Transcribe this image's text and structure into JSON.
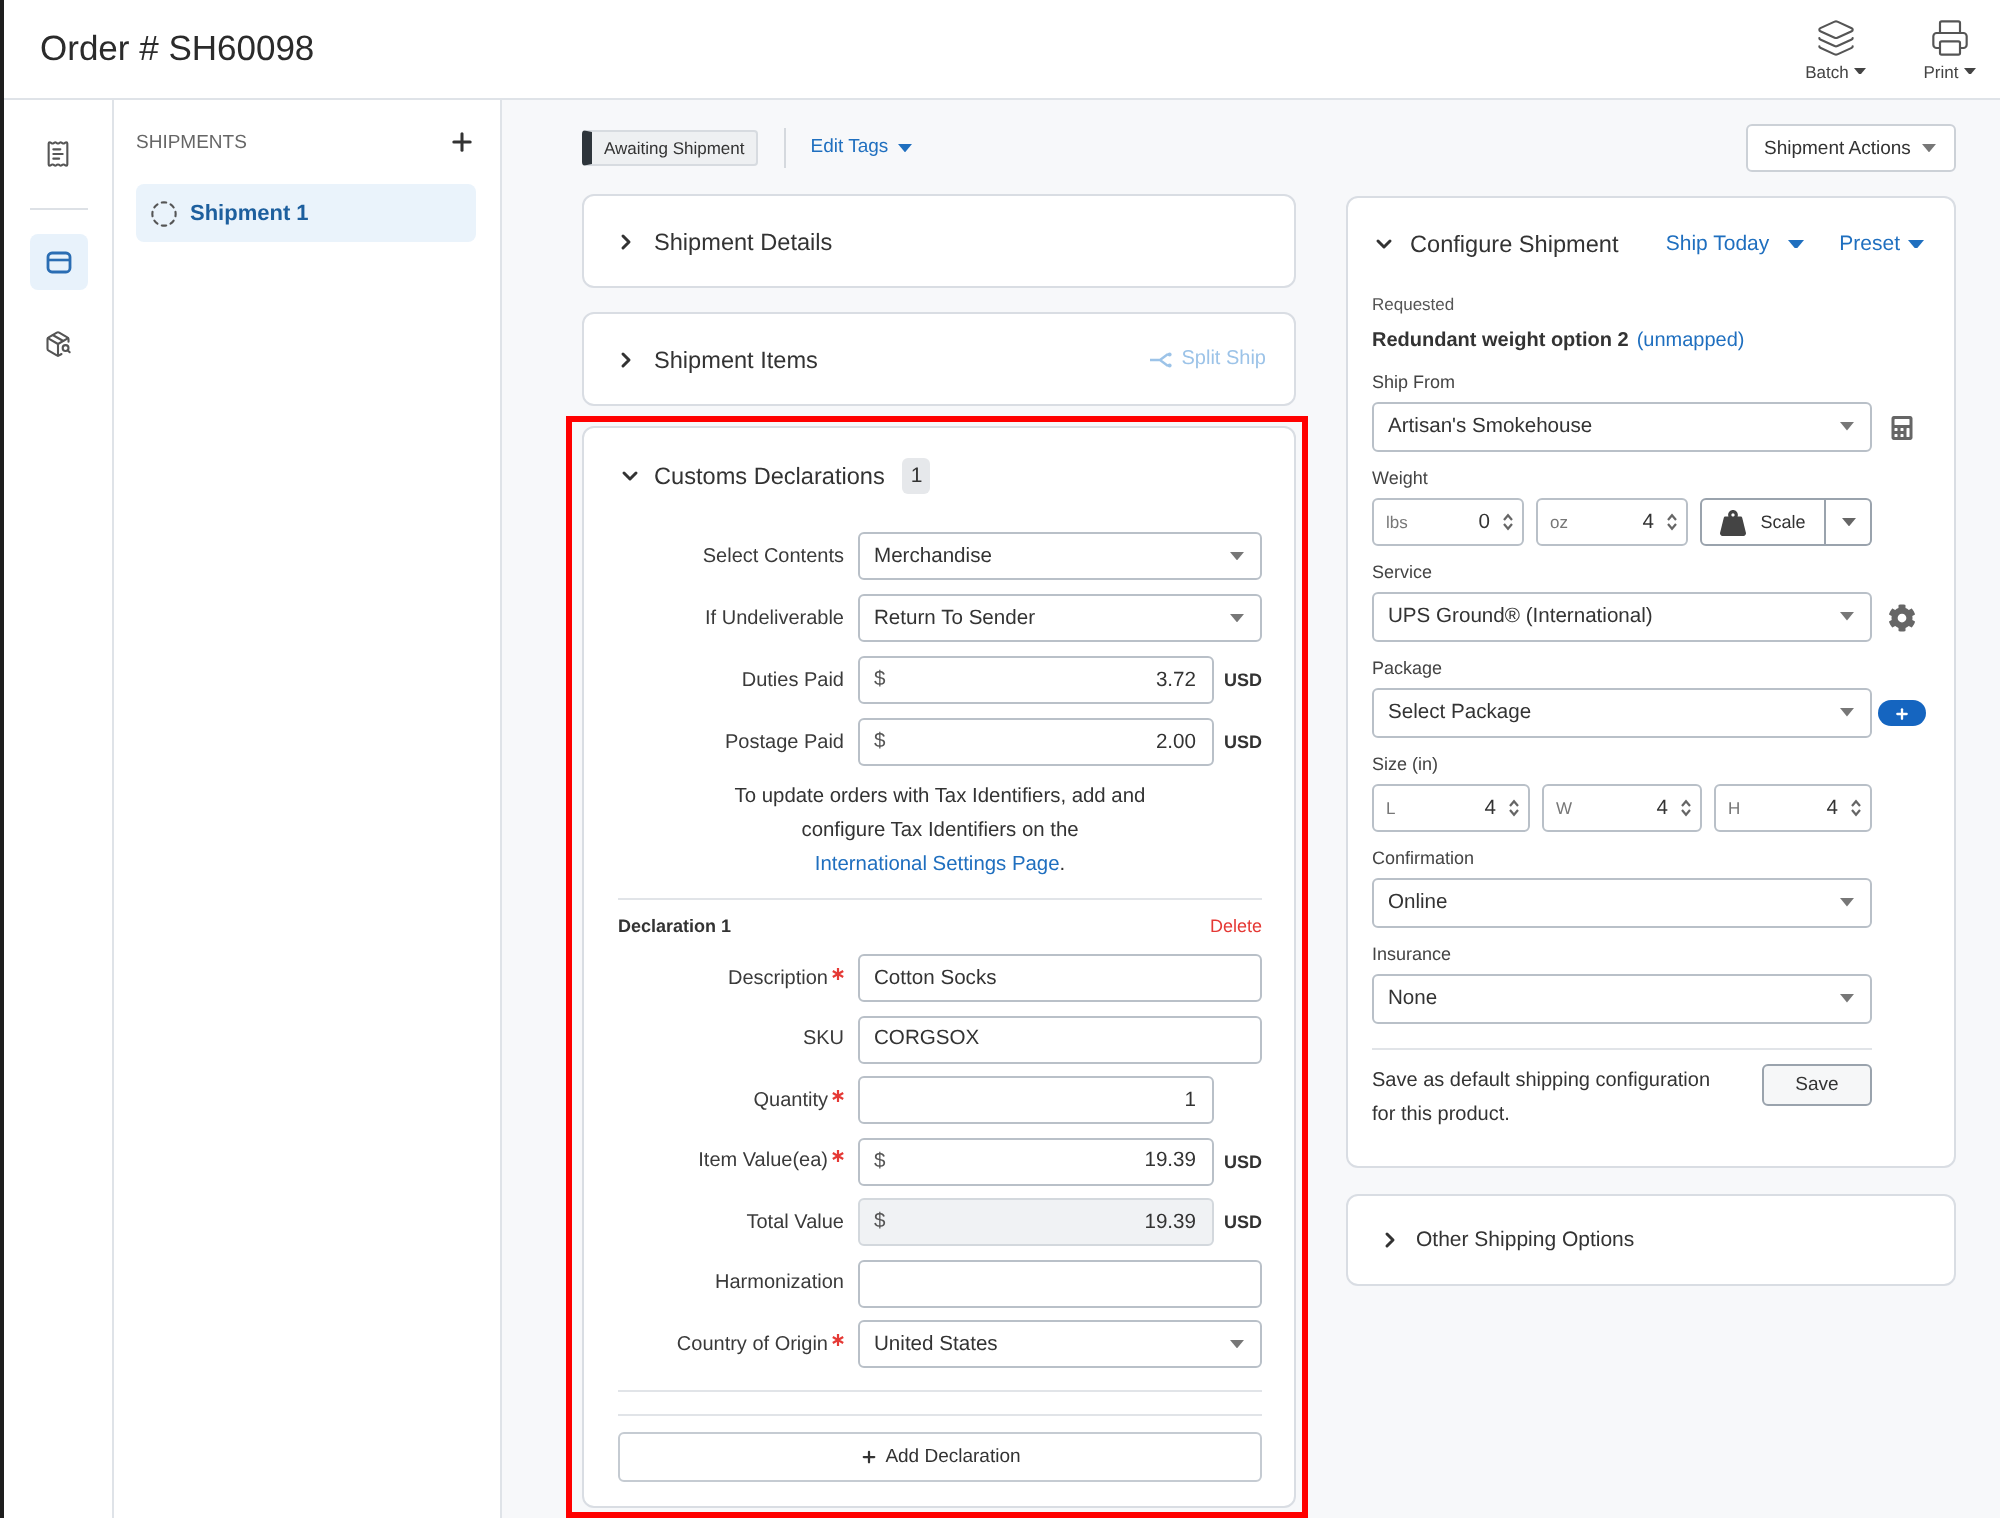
{
  "header": {
    "title": "Order # SH60098",
    "actions": [
      {
        "label": "Batch"
      },
      {
        "label": "Print"
      }
    ]
  },
  "nav_rail": {
    "items": [
      {
        "selected": false
      },
      {
        "selected": true
      },
      {
        "selected": false
      }
    ]
  },
  "shipments": {
    "heading": "SHIPMENTS",
    "items": [
      {
        "label": "Shipment 1",
        "selected": true
      }
    ]
  },
  "toolbar": {
    "status_tag": "Awaiting Shipment",
    "edit_tags": "Edit Tags",
    "actions_button": "Shipment Actions"
  },
  "sections": [
    {
      "title": "Shipment Details",
      "expanded": false
    },
    {
      "title": "Shipment Items",
      "expanded": false,
      "action": {
        "label": "Split Ship",
        "disabled": true
      }
    }
  ],
  "customs": {
    "title": "Customs Declarations",
    "count": "1",
    "expanded": true,
    "highlighted": true,
    "fields": [
      {
        "kind": "select",
        "label": "Select Contents",
        "value": "Merchandise"
      },
      {
        "kind": "select",
        "label": "If Undeliverable",
        "value": "Return To Sender"
      },
      {
        "kind": "money",
        "label": "Duties Paid",
        "currency_symbol": "$",
        "value": "3.72",
        "currency": "USD"
      },
      {
        "kind": "money",
        "label": "Postage Paid",
        "currency_symbol": "$",
        "value": "2.00",
        "currency": "USD"
      }
    ],
    "note": "To update orders with Tax Identifiers, add and configure Tax Identifiers on the",
    "note_link": "International Settings Page",
    "note_end": ".",
    "declarations": [
      {
        "title": "Declaration 1",
        "delete": "Delete",
        "fields": [
          {
            "kind": "text",
            "label": "Description",
            "required": true,
            "disabled": false,
            "value": "Cotton Socks"
          },
          {
            "kind": "text",
            "label": "SKU",
            "required": false,
            "disabled": false,
            "value": "CORGSOX"
          },
          {
            "kind": "number",
            "label": "Quantity",
            "required": true,
            "disabled": false,
            "value": "1"
          },
          {
            "kind": "money",
            "label": "Item Value(ea)",
            "required": true,
            "disabled": false,
            "currency_symbol": "$",
            "value": "19.39",
            "currency": "USD"
          },
          {
            "kind": "money",
            "label": "Total Value",
            "required": false,
            "disabled": true,
            "currency_symbol": "$",
            "value": "19.39",
            "currency": "USD"
          },
          {
            "kind": "text",
            "label": "Harmonization",
            "required": false,
            "disabled": false
          },
          {
            "kind": "select",
            "label": "Country of Origin",
            "required": true,
            "disabled": false,
            "value": "United States"
          }
        ]
      }
    ],
    "add_button": "Add Declaration"
  },
  "configure": {
    "title": "Configure Shipment",
    "expanded": true,
    "ship_date": "Ship Today",
    "preset": "Preset",
    "requested": {
      "label": "Requested",
      "value": "Redundant weight option 2",
      "link": "(unmapped)"
    },
    "ship_from": {
      "label": "Ship From",
      "value": "Artisan's Smokehouse"
    },
    "weight": {
      "label": "Weight",
      "inputs": [
        {
          "unit": "lbs",
          "value": "0"
        },
        {
          "unit": "oz",
          "value": "4"
        }
      ],
      "scale_button": "Scale"
    },
    "service": {
      "label": "Service",
      "value": "UPS Ground® (International)"
    },
    "package": {
      "label": "Package",
      "value": "Select Package"
    },
    "size": {
      "label": "Size (in)",
      "inputs": [
        {
          "unit": "L",
          "value": "4"
        },
        {
          "unit": "W",
          "value": "4"
        },
        {
          "unit": "H",
          "value": "4"
        }
      ]
    },
    "confirmation": {
      "label": "Confirmation",
      "value": "Online"
    },
    "insurance": {
      "label": "Insurance",
      "value": "None"
    },
    "save_note": "Save as default shipping configuration for this product.",
    "save_button": "Save"
  },
  "other_options": {
    "title": "Other Shipping Options",
    "expanded": false
  }
}
